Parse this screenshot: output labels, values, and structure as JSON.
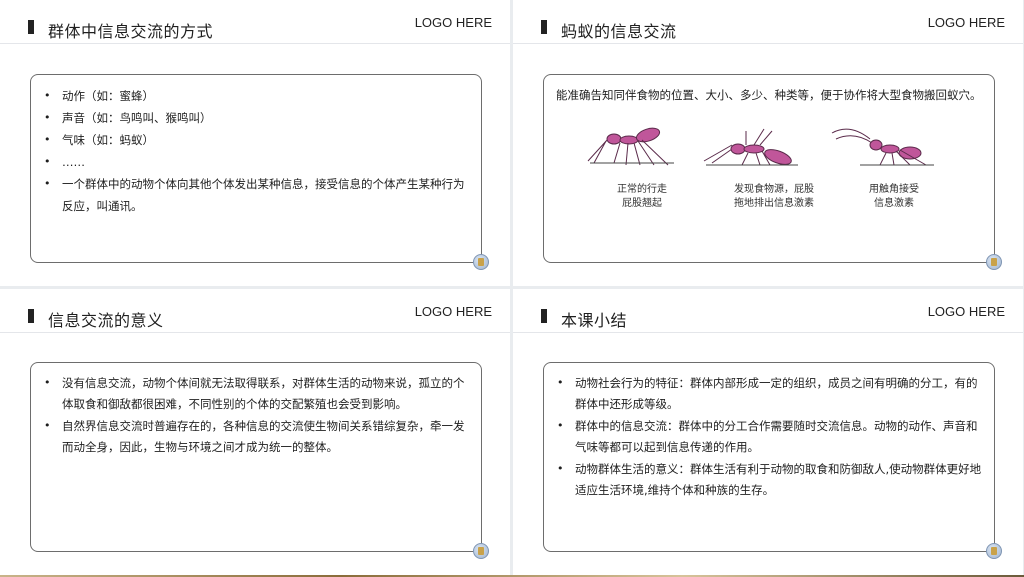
{
  "slides": [
    {
      "title": "群体中信息交流的方式",
      "logo": "LOGO HERE",
      "bullets": [
        "动作（如：蜜蜂）",
        "声音（如：鸟鸣叫、猴鸣叫）",
        "气味（如：蚂蚁）",
        "……",
        "一个群体中的动物个体向其他个体发出某种信息，接受信息的个体产生某种行为反应，叫通讯。"
      ]
    },
    {
      "title": "蚂蚁的信息交流",
      "logo": "LOGO HERE",
      "description": "能准确告知同伴食物的位置、大小、多少、种类等，便于协作将大型食物搬回蚁穴。",
      "captions": [
        [
          "正常的行走",
          "屁股翘起"
        ],
        [
          "发现食物源，屁股",
          "拖地排出信息激素"
        ],
        [
          "用触角接受",
          "信息激素"
        ]
      ]
    },
    {
      "title": "信息交流的意义",
      "logo": "LOGO HERE",
      "bullets": [
        "没有信息交流，动物个体间就无法取得联系，对群体生活的动物来说，孤立的个体取食和御敌都很困难，不同性别的个体的交配繁殖也会受到影响。",
        "自然界信息交流时普遍存在的，各种信息的交流使生物间关系错综复杂，牵一发而动全身，因此，生物与环境之间才成为统一的整体。"
      ]
    },
    {
      "title": "本课小结",
      "logo": "LOGO HERE",
      "bullets": [
        "动物社会行为的特征：群体内部形成一定的组织，成员之间有明确的分工，有的群体中还形成等级。",
        "群体中的信息交流：群体中的分工合作需要随时交流信息。动物的动作、声音和气味等都可以起到信息传递的作用。",
        "动物群体生活的意义：群体生活有利于动物的取食和防御敌人,使动物群体更好地适应生活环境,维持个体和种族的生存。"
      ]
    }
  ],
  "colors": {
    "ant": "#c0569a",
    "ant_dark": "#7a2f62",
    "card_border": "#6d6d6d"
  },
  "icons": {
    "pin": "pushpin-icon"
  }
}
